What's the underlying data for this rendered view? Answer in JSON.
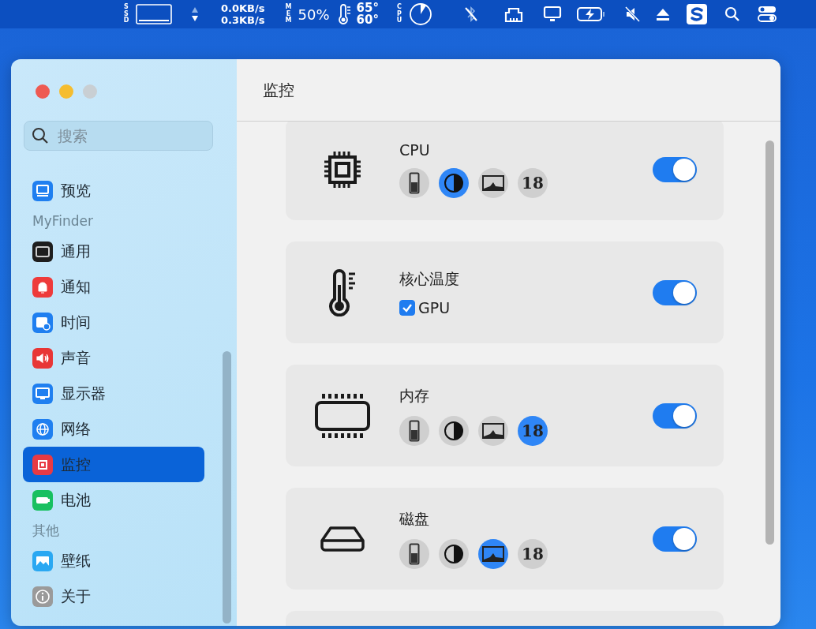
{
  "menu_bar": {
    "ssd_label": "SSD",
    "net_up": "0.0KB/s",
    "net_down": "0.3KB/s",
    "mem_label": "MEM",
    "mem_value": "50%",
    "temps": [
      "65°",
      "60°"
    ],
    "cpu_label": "CPU"
  },
  "sidebar": {
    "search": {
      "placeholder": "搜索"
    },
    "sections": [
      {
        "items": [
          {
            "label": "预览",
            "kind": "preview",
            "selected": false
          }
        ]
      },
      {
        "title": "MyFinder",
        "items": [
          {
            "label": "通用",
            "kind": "general",
            "selected": false
          },
          {
            "label": "通知",
            "kind": "notify",
            "selected": false
          },
          {
            "label": "时间",
            "kind": "time",
            "selected": false
          },
          {
            "label": "声音",
            "kind": "sound",
            "selected": false
          },
          {
            "label": "显示器",
            "kind": "display",
            "selected": false
          },
          {
            "label": "网络",
            "kind": "network",
            "selected": false
          },
          {
            "label": "监控",
            "kind": "monitor",
            "selected": true
          },
          {
            "label": "电池",
            "kind": "battery",
            "selected": false
          }
        ]
      },
      {
        "title": "其他",
        "items": [
          {
            "label": "壁纸",
            "kind": "wallpaper",
            "selected": false
          },
          {
            "label": "关于",
            "kind": "about",
            "selected": false
          }
        ]
      }
    ]
  },
  "content": {
    "title": "监控",
    "modules": [
      {
        "name": "CPU",
        "kind": "cpu",
        "enabled": true,
        "styles": [
          {
            "kind": "bar",
            "selected": false
          },
          {
            "kind": "pie",
            "selected": true
          },
          {
            "kind": "chart",
            "selected": false
          },
          {
            "kind": "number",
            "label": "18",
            "selected": false
          }
        ]
      },
      {
        "name": "核心温度",
        "kind": "thermometer",
        "enabled": true,
        "options": [
          {
            "label": "GPU",
            "checked": true
          }
        ]
      },
      {
        "name": "内存",
        "kind": "memory",
        "enabled": true,
        "styles": [
          {
            "kind": "bar",
            "selected": false
          },
          {
            "kind": "pie",
            "selected": false
          },
          {
            "kind": "chart",
            "selected": false
          },
          {
            "kind": "number",
            "label": "18",
            "selected": true
          }
        ]
      },
      {
        "name": "磁盘",
        "kind": "disk",
        "enabled": true,
        "styles": [
          {
            "kind": "bar",
            "selected": false
          },
          {
            "kind": "pie",
            "selected": false
          },
          {
            "kind": "chart",
            "selected": true
          },
          {
            "kind": "number",
            "label": "18",
            "selected": false
          }
        ]
      }
    ]
  }
}
